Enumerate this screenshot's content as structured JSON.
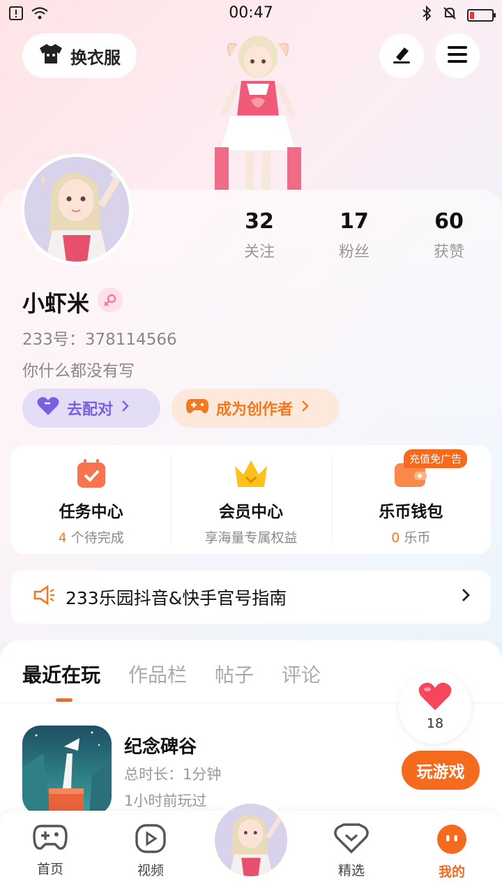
{
  "status": {
    "time": "00:47"
  },
  "top": {
    "dress_label": "换衣服"
  },
  "stats": [
    {
      "num": "32",
      "label": "关注"
    },
    {
      "num": "17",
      "label": "粉丝"
    },
    {
      "num": "60",
      "label": "获赞"
    }
  ],
  "profile": {
    "name": "小虾米",
    "uid": "233号：378114566",
    "bio": "你什么都没有写",
    "match_label": "去配对",
    "creator_label": "成为创作者"
  },
  "features": [
    {
      "title": "任务中心",
      "sub_num": "4",
      "sub_text": " 个待完成"
    },
    {
      "title": "会员中心",
      "sub_text": "享海量专属权益"
    },
    {
      "title": "乐币钱包",
      "sub_num": "0",
      "sub_text": " 乐币",
      "badge": "充值免广告"
    }
  ],
  "notice": {
    "text": "233乐园抖音&快手官号指南"
  },
  "tabs": [
    "最近在玩",
    "作品栏",
    "帖子",
    "评论"
  ],
  "game": {
    "title": "纪念碑谷",
    "duration": "总时长：1分钟",
    "last_played": "1小时前玩过",
    "play_label": "玩游戏"
  },
  "like": {
    "count": "18"
  },
  "nav": [
    {
      "label": "首页"
    },
    {
      "label": "视频"
    },
    {
      "label": "精选"
    },
    {
      "label": "我的"
    }
  ],
  "colors": {
    "accent": "#f56b1e",
    "purple": "#7a5de0",
    "pink": "#f27aa0"
  }
}
